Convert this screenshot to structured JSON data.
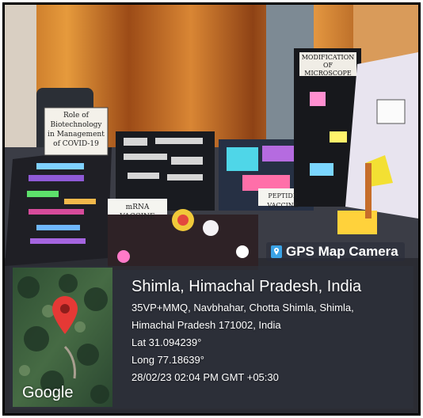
{
  "posters": {
    "covid": "Role of Biotechnology in Management of COVID-19",
    "mrna": "mRNA VACCINE",
    "peptide": "PEPTIDE VACCINE",
    "microscope": "MODIFICATION OF MICROSCOPE"
  },
  "gps_badge": {
    "icon": "map-pin-icon",
    "label": "GPS Map Camera"
  },
  "map": {
    "brand": "Google",
    "pin_color": "#e53935"
  },
  "location": {
    "city": "Shimla, Himachal Pradesh, India",
    "address_line1": "35VP+MMQ, Navbhahar, Chotta Shimla, Shimla,",
    "address_line2": "Himachal Pradesh 171002, India",
    "lat": "Lat 31.094239°",
    "long": "Long 77.18639°",
    "timestamp": "28/02/23 02:04 PM GMT +05:30"
  }
}
